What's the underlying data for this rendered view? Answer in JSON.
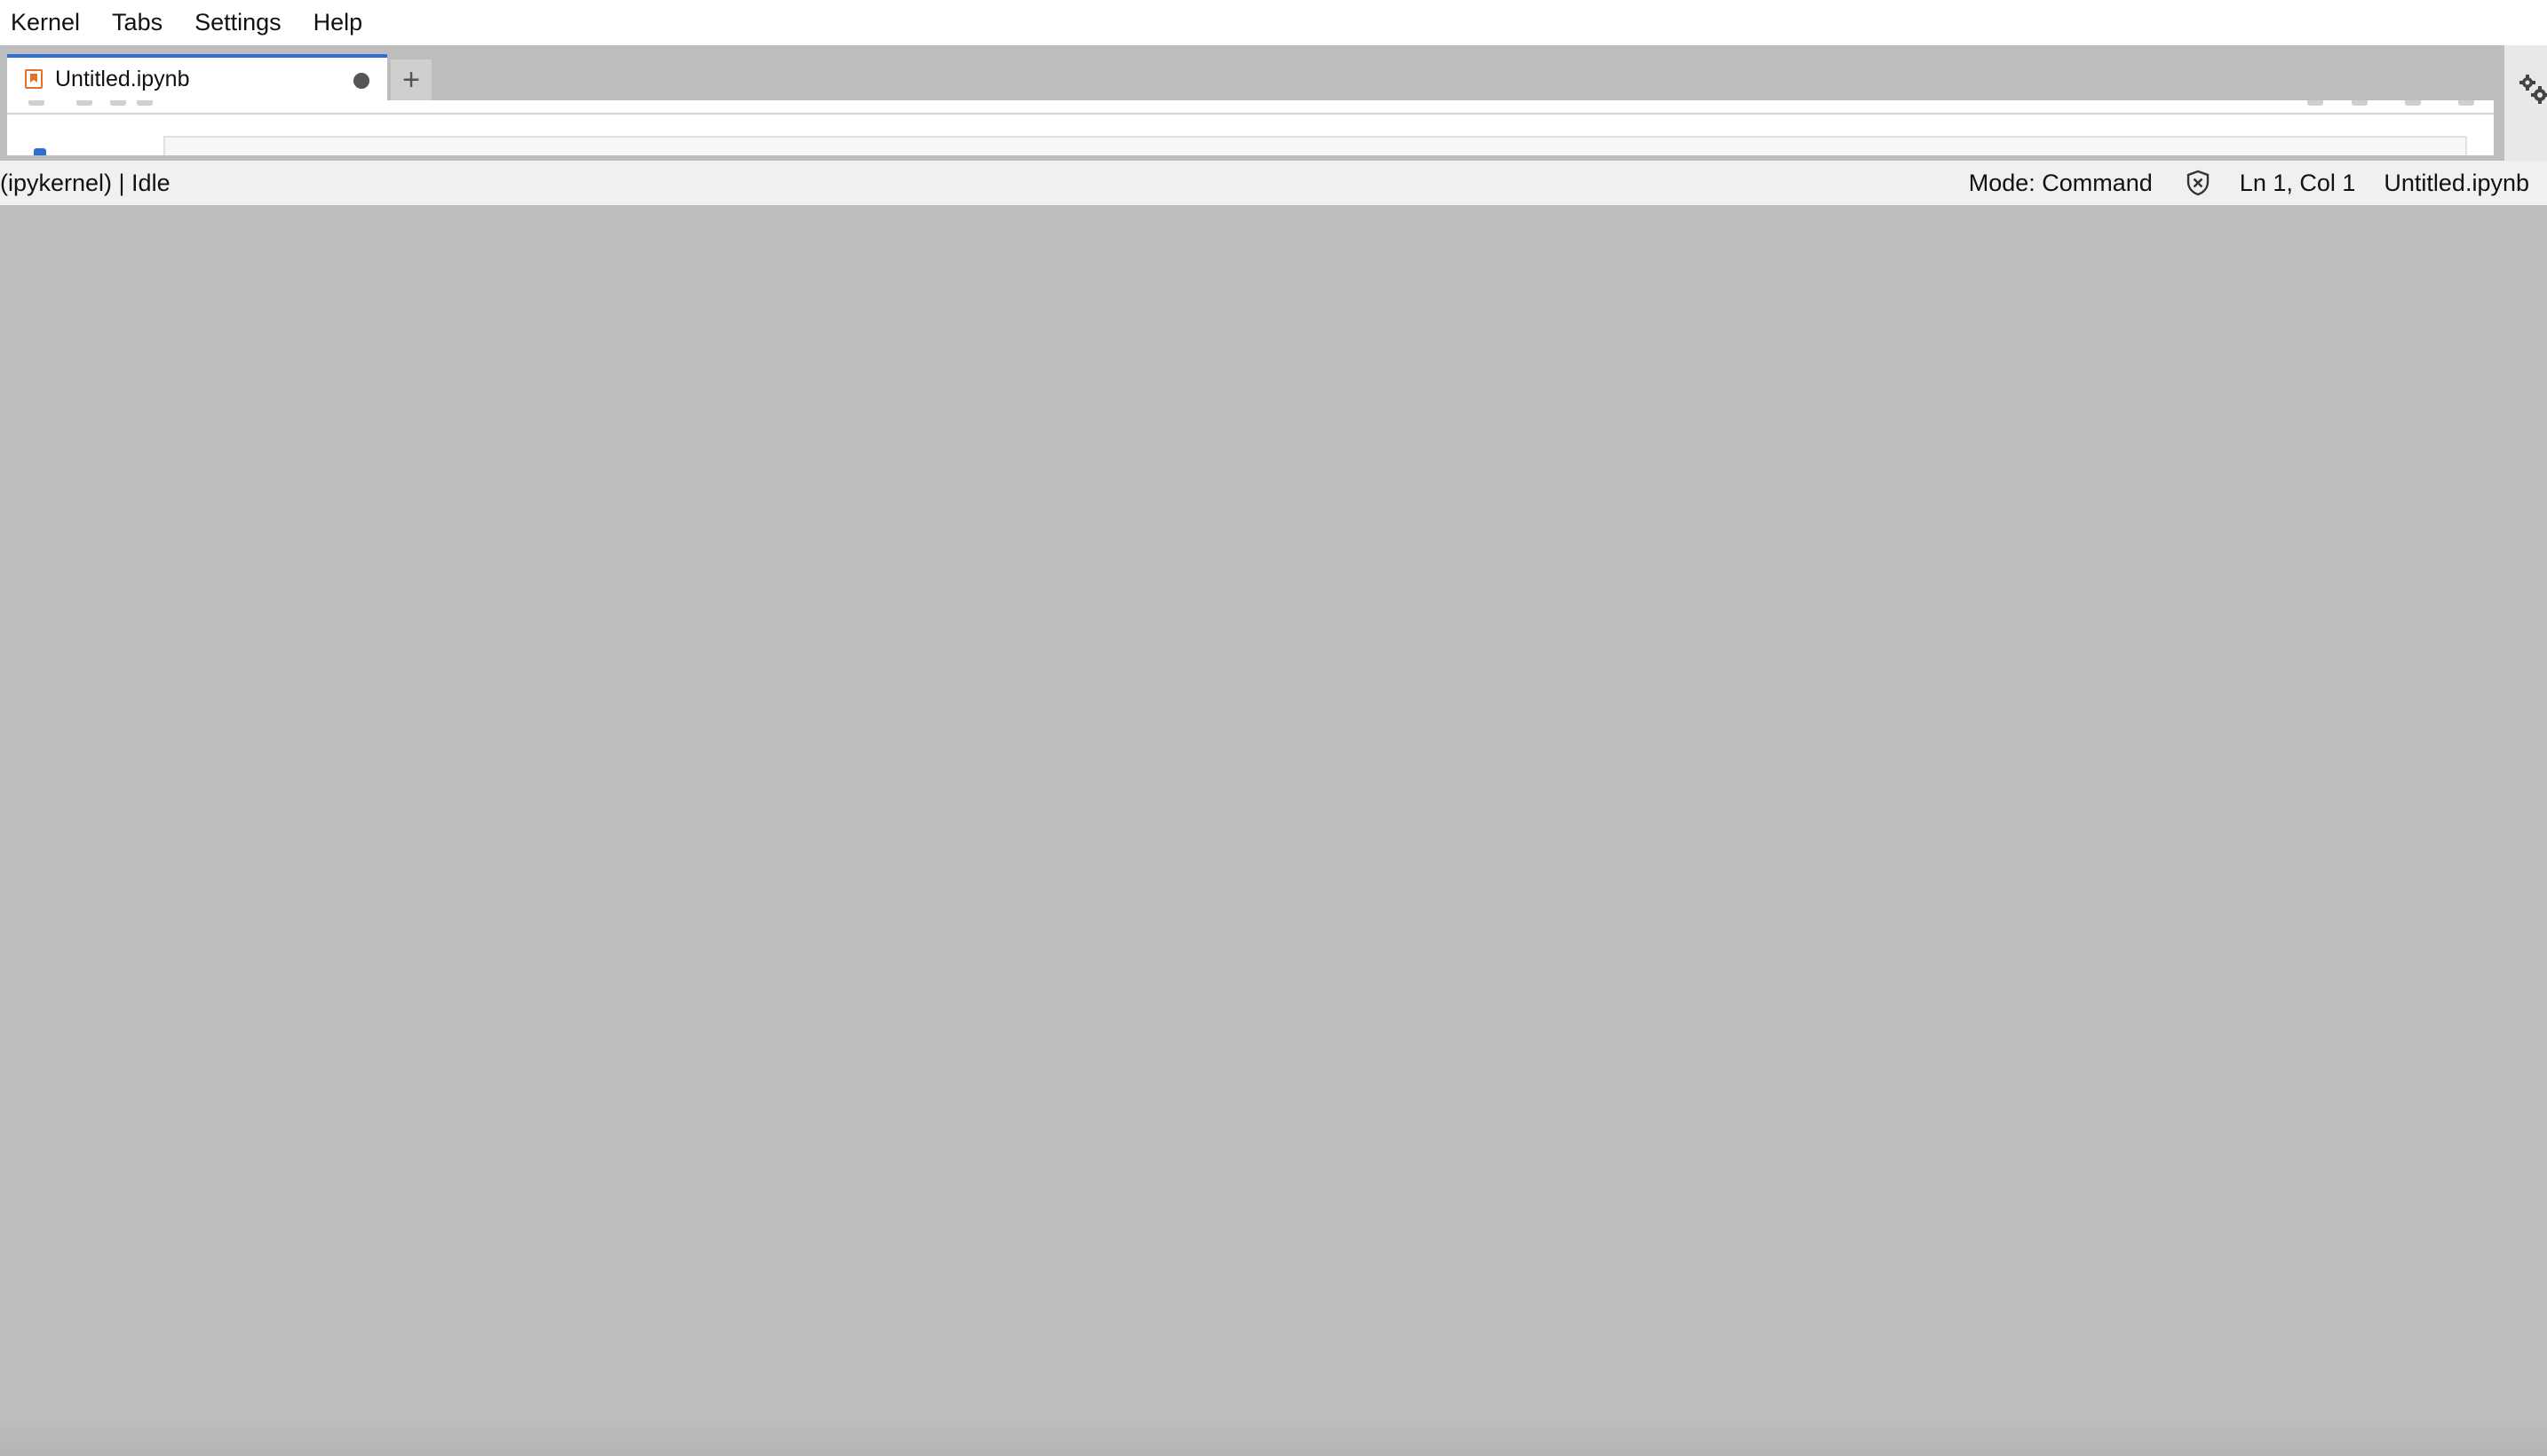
{
  "menubar": {
    "items": [
      "Kernel",
      "Tabs",
      "Settings",
      "Help"
    ]
  },
  "tabs": [
    {
      "label": "Untitled.ipynb",
      "icon": "notebook-icon",
      "dirty": true
    }
  ],
  "add_tab_label": "+",
  "statusbar": {
    "kernel_status": "(ipykernel) | Idle",
    "mode": "Mode: Command",
    "cursor": "Ln 1, Col 1",
    "filename": "Untitled.ipynb",
    "trust_icon": "not-trusted-shield-icon"
  },
  "colors": {
    "accent": "#2f6fd1",
    "notebook_icon": "#e5702a",
    "overlay_background": "#bdbdbd"
  }
}
